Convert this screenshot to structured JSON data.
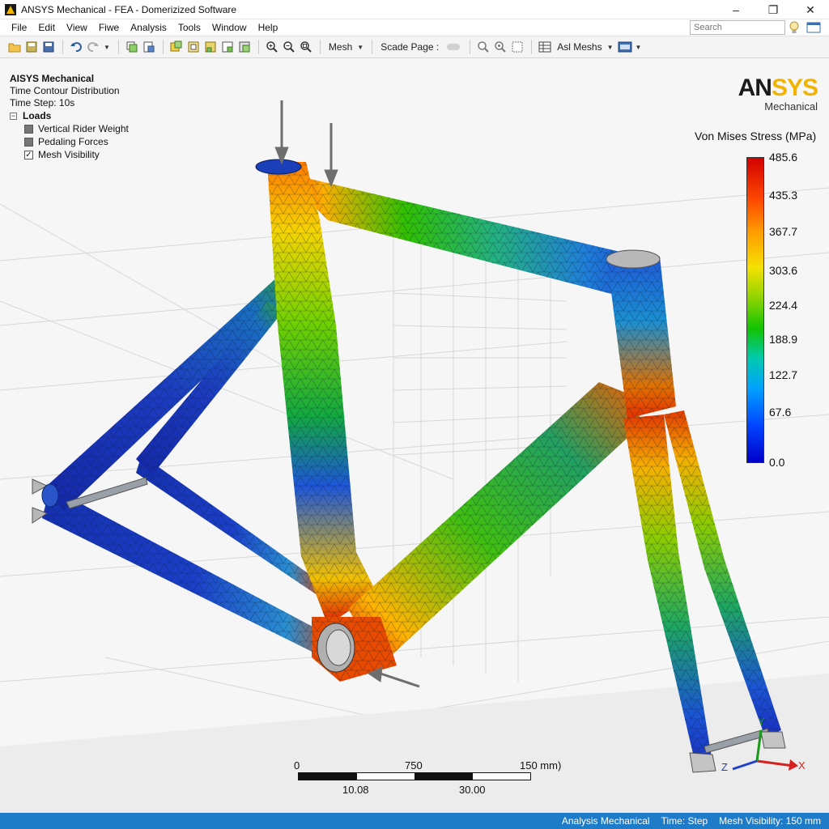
{
  "window": {
    "title": "ANSYS Mechanical - FEA - Domerizized Software",
    "minimize": "–",
    "maximize": "❐",
    "close": "✕"
  },
  "menu": {
    "items": [
      "File",
      "Edit",
      "View",
      "Fiwe",
      "Analysis",
      "Tools",
      "Window",
      "Help"
    ],
    "search_placeholder": "Search"
  },
  "toolbar": {
    "mesh_label": "Mesh",
    "scale_label": "Scade Page :",
    "all_meshs_label": "Asl Meshs"
  },
  "tree": {
    "app_title": "AISYS Mechanical",
    "subtitle": "Time Contour Distribution",
    "time_step": "Time Step: 10s",
    "loads_label": "Loads",
    "expander": "−",
    "items": [
      {
        "label": "Vertical Rider Weight",
        "kind": "square"
      },
      {
        "label": "Pedaling Forces",
        "kind": "square"
      },
      {
        "label": "Mesh Visibility",
        "kind": "checkbox",
        "checked": true
      }
    ]
  },
  "brand": {
    "name_a": "AN",
    "name_b": "SYS",
    "sub": "Mechanical"
  },
  "legend": {
    "title": "Von Mises Stress (MPa)",
    "values": [
      "485.6",
      "435.3",
      "367.7",
      "303.6",
      "224.4",
      "188.9",
      "122.7",
      "67.6",
      "0.0"
    ]
  },
  "scale": {
    "top_left": "0",
    "top_mid": "750",
    "top_right": "150 mm)",
    "bottom_left": "10.08",
    "bottom_right": "30.00"
  },
  "axes": {
    "x": "X",
    "y": "Y",
    "z": "Z"
  },
  "status": {
    "items": [
      "Analysis Mechanical",
      "Time: Step",
      "Mesh Visibility: 150 mm"
    ]
  },
  "colors": {
    "status_bar": "#1e7bc8",
    "brand_accent": "#f2b300"
  }
}
